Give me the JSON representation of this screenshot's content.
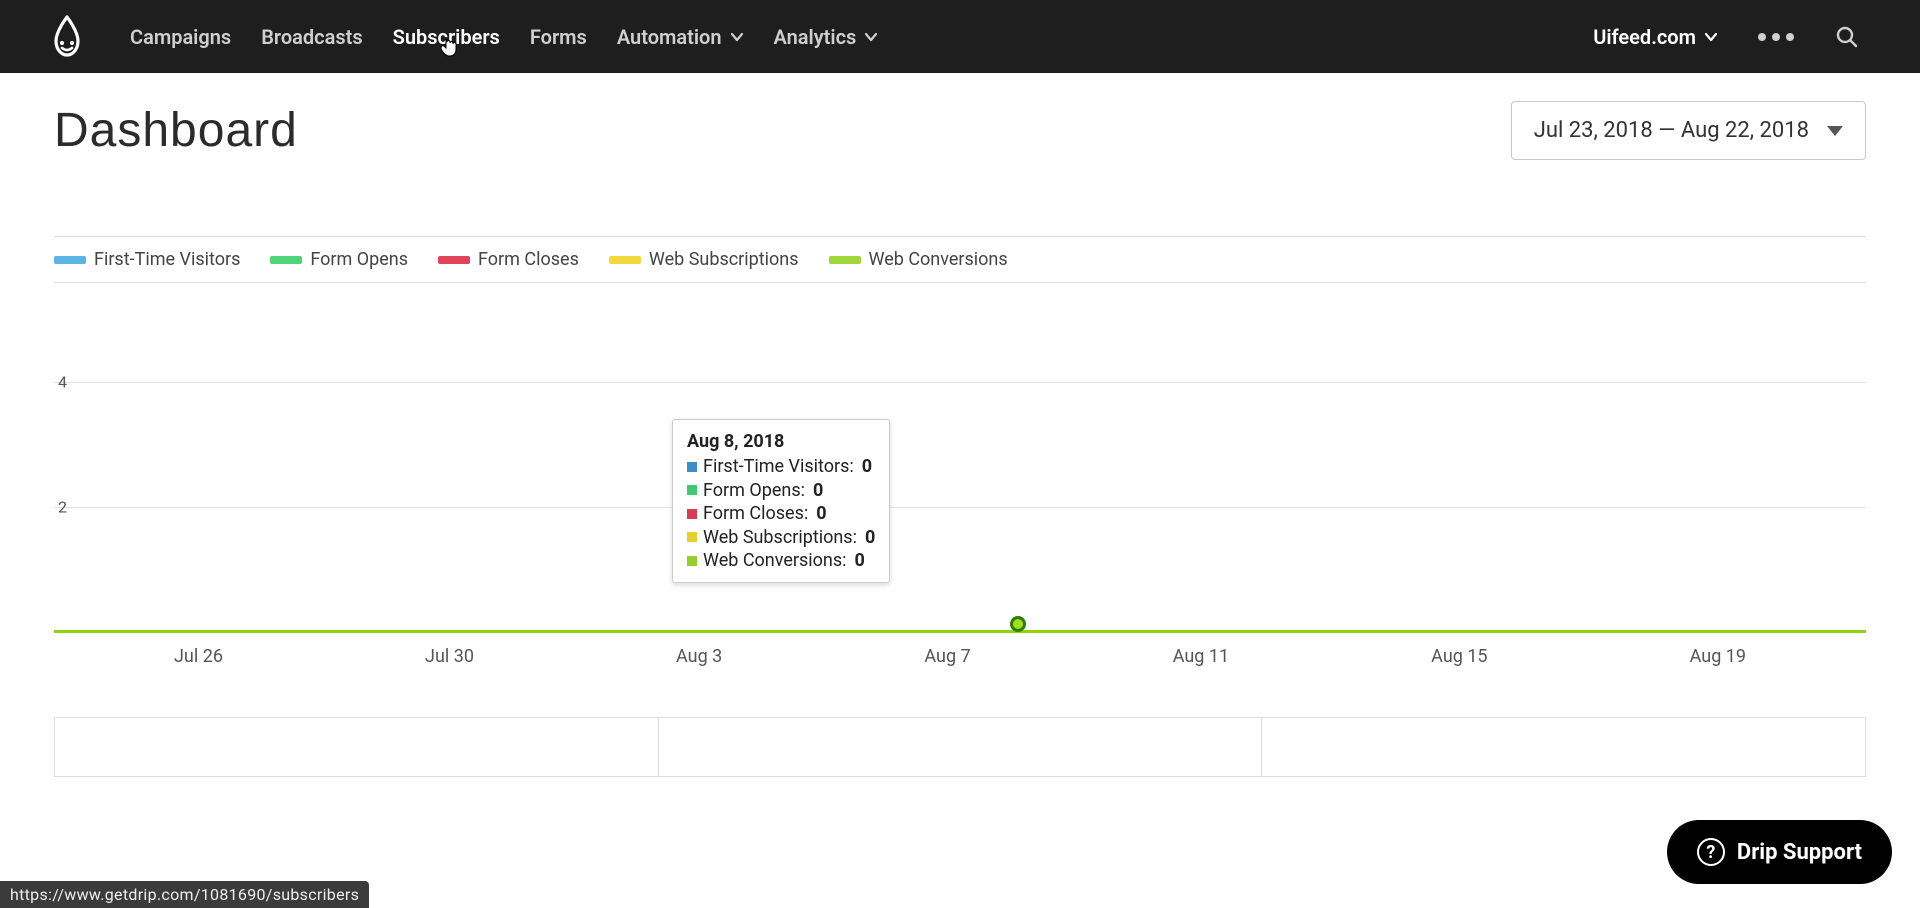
{
  "nav": {
    "items": [
      {
        "label": "Campaigns",
        "has_menu": false
      },
      {
        "label": "Broadcasts",
        "has_menu": false
      },
      {
        "label": "Subscribers",
        "has_menu": false,
        "active": true
      },
      {
        "label": "Forms",
        "has_menu": false
      },
      {
        "label": "Automation",
        "has_menu": true
      },
      {
        "label": "Analytics",
        "has_menu": true
      }
    ],
    "account_label": "Uifeed.com"
  },
  "page": {
    "title": "Dashboard",
    "date_range": "Jul 23, 2018 — Aug 22, 2018"
  },
  "legend": [
    {
      "name": "First-Time Visitors",
      "color": "#5bb4e6"
    },
    {
      "name": "Form Opens",
      "color": "#4fd47a"
    },
    {
      "name": "Form Closes",
      "color": "#e0445a"
    },
    {
      "name": "Web Subscriptions",
      "color": "#f2d93b"
    },
    {
      "name": "Web Conversions",
      "color": "#9fd63a"
    }
  ],
  "tooltip": {
    "date": "Aug 8, 2018",
    "rows": [
      {
        "label": "First-Time Visitors:",
        "value": "0",
        "color": "#3a8ecb"
      },
      {
        "label": "Form Opens:",
        "value": "0",
        "color": "#40c96c"
      },
      {
        "label": "Form Closes:",
        "value": "0",
        "color": "#d83b52"
      },
      {
        "label": "Web Subscriptions:",
        "value": "0",
        "color": "#e9cf2b"
      },
      {
        "label": "Web Conversions:",
        "value": "0",
        "color": "#95cf2d"
      }
    ]
  },
  "chart_data": {
    "type": "line",
    "ylim": [
      0,
      4
    ],
    "y_ticks": [
      2,
      4
    ],
    "x_ticks": [
      "Jul 26",
      "Jul 30",
      "Aug 3",
      "Aug 7",
      "Aug 11",
      "Aug 15",
      "Aug 19"
    ],
    "hover_x_pct": 53.2,
    "series": [
      {
        "name": "First-Time Visitors",
        "color": "#5bb4e6",
        "values": [
          0,
          0,
          0,
          0,
          0,
          0,
          0
        ]
      },
      {
        "name": "Form Opens",
        "color": "#4fd47a",
        "values": [
          0,
          0,
          0,
          0,
          0,
          0,
          0
        ]
      },
      {
        "name": "Form Closes",
        "color": "#e0445a",
        "values": [
          0,
          0,
          0,
          0,
          0,
          0,
          0
        ]
      },
      {
        "name": "Web Subscriptions",
        "color": "#f2d93b",
        "values": [
          0,
          0,
          0,
          0,
          0,
          0,
          0
        ]
      },
      {
        "name": "Web Conversions",
        "color": "#9fd63a",
        "values": [
          0,
          0,
          0,
          0,
          0,
          0,
          0
        ]
      }
    ]
  },
  "support": {
    "label": "Drip Support"
  },
  "statusbar": {
    "text": "https://www.getdrip.com/1081690/subscribers"
  }
}
